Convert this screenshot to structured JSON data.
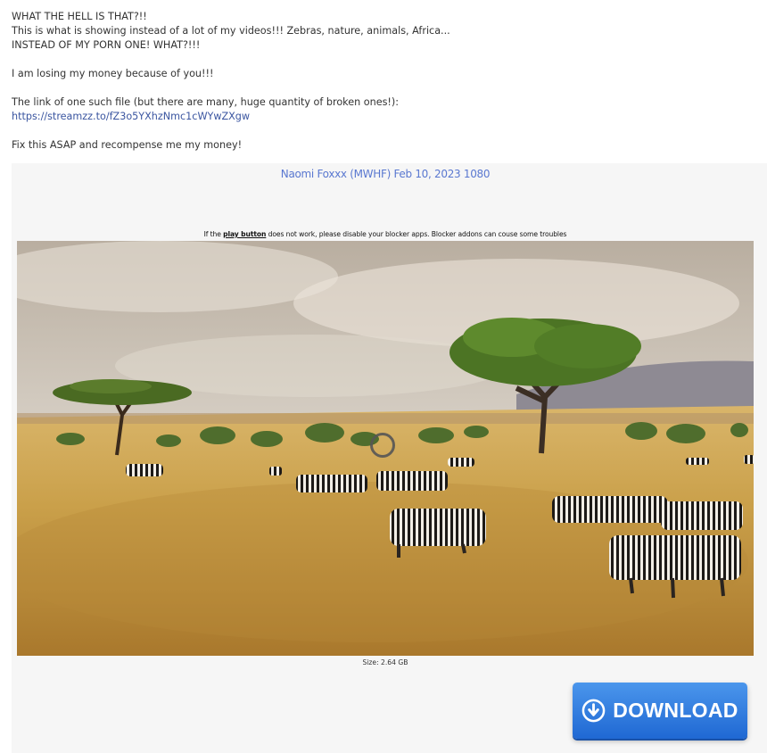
{
  "message": {
    "lines": [
      "WHAT THE HELL IS THAT?!!",
      "This is what is showing instead of a lot of my videos!!! Zebras, nature, animals, Africa...",
      "INSTEAD OF MY PORN ONE! WHAT?!!!",
      "I am losing my money because of you!!!",
      "The link of one such file (but there are many, huge quantity of broken ones!):",
      "https://streamzz.to/fZ3o5YXhzNmc1cWYwZXgw",
      "Fix this ASAP and recompense me my money!"
    ]
  },
  "file_page": {
    "title": "Naomi Foxxx (MWHF) Feb 10, 2023 1080",
    "notice_prefix": "If the",
    "notice_bold": "play button",
    "notice_suffix": "does not work, please disable your blocker apps. Blocker addons can couse some troubles",
    "size_text": "Size: 2.64 GB",
    "download_label": "DOWNLOAD",
    "icons": {
      "play": "loading-ring-icon",
      "download": "download-arrow-icon"
    },
    "colors": {
      "title": "#5a78d0",
      "download_button": "#2f7fe0",
      "link": "#3a55a0"
    }
  }
}
